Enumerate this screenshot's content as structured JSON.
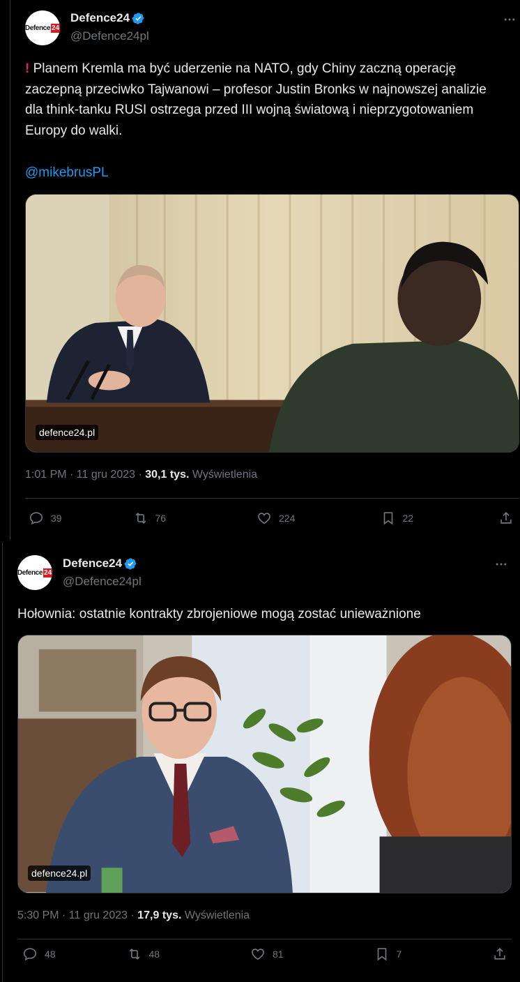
{
  "tweets": [
    {
      "author": {
        "name": "Defence24",
        "handle": "@Defence24pl",
        "avatar_text": "Defence",
        "avatar_box": "24"
      },
      "alert_icon": "!",
      "text": "Planem Kremla ma być uderzenie na NATO, gdy Chiny zaczną operację zaczepną przeciwko Tajwanowi – profesor Justin Bronks w najnowszej analizie dla think-tanku RUSI ostrzega przed III wojną światową i nieprzygotowaniem Europy do walki.",
      "mention": "@mikebrusPL",
      "media_source": "defence24.pl",
      "time": "1:01 PM · 11 gru 2023 · ",
      "views_count": "30,1 tys.",
      "views_label": " Wyświetlenia",
      "replies": "39",
      "reposts": "76",
      "likes": "224",
      "bookmarks": "22"
    },
    {
      "author": {
        "name": "Defence24",
        "handle": "@Defence24pl",
        "avatar_text": "Defence",
        "avatar_box": "24"
      },
      "text": "Hołownia: ostatnie kontrakty zbrojeniowe mogą zostać unieważnione",
      "media_source": "defence24.pl",
      "time": "5:30 PM · 11 gru 2023 · ",
      "views_count": "17,9 tys.",
      "views_label": " Wyświetlenia",
      "replies": "48",
      "reposts": "48",
      "likes": "81",
      "bookmarks": "7"
    }
  ],
  "colors": {
    "background": "#000000",
    "text": "#e7e9ea",
    "muted": "#71767b",
    "link": "#1d9bf0",
    "verified": "#1d9bf0",
    "alert": "#e0245e",
    "divider": "#2f3336"
  }
}
